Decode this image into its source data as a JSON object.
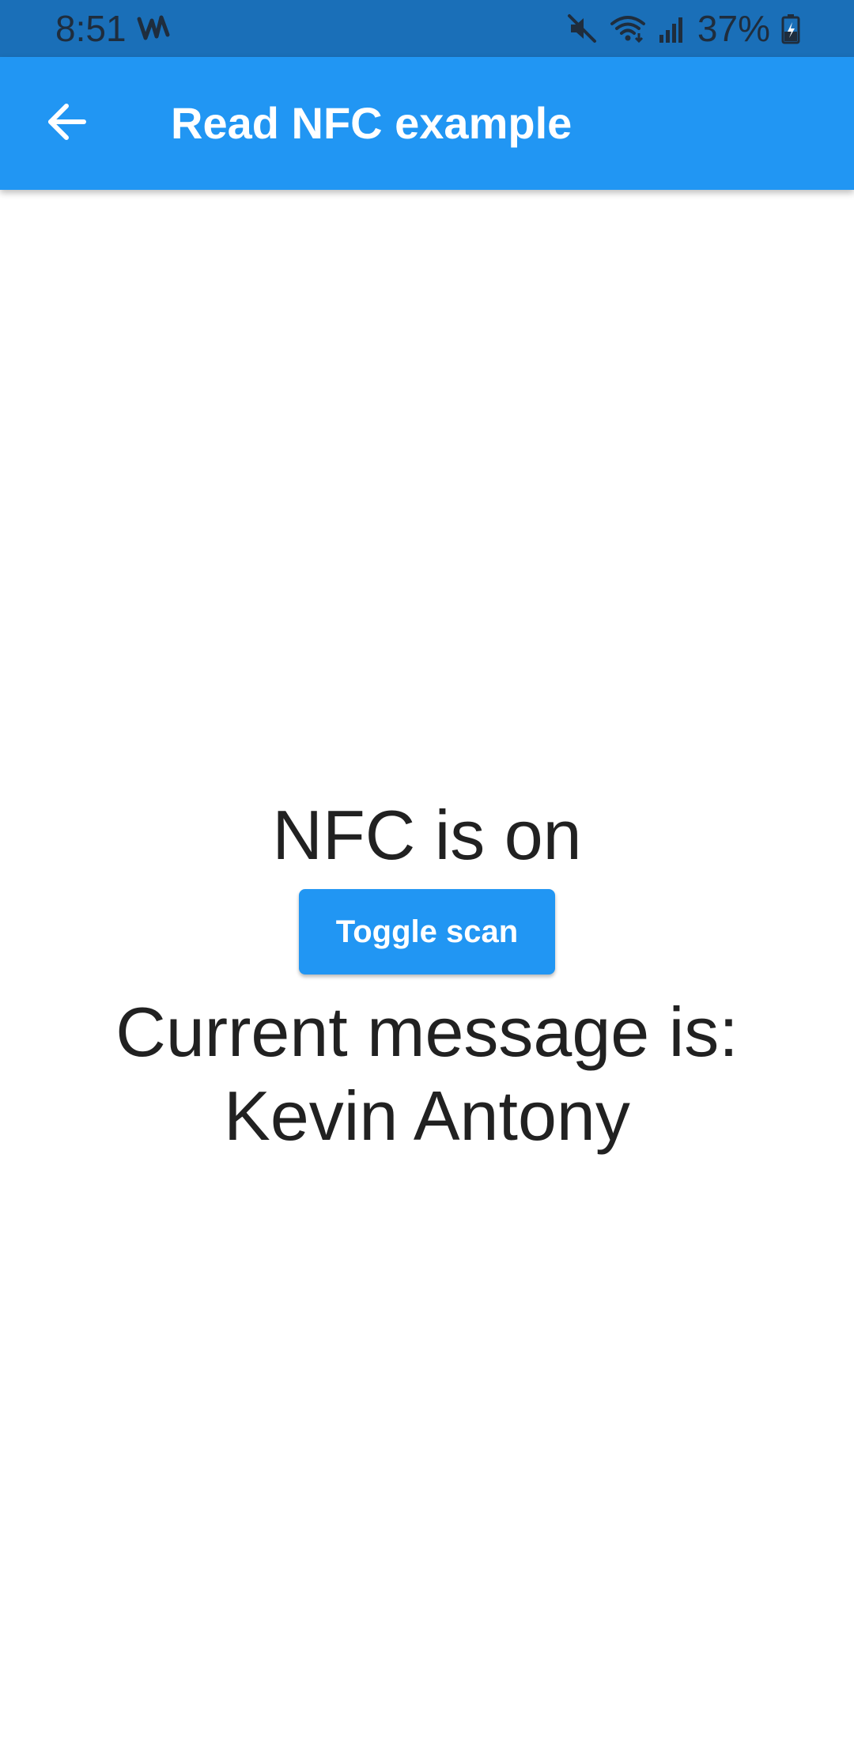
{
  "status_bar": {
    "time": "8:51",
    "battery_percent": "37%",
    "icons": [
      "pulse-app-icon",
      "mute-icon",
      "wifi-icon",
      "signal-icon",
      "battery-charging-icon"
    ],
    "background_color": "#1a6fb8"
  },
  "app_bar": {
    "title": "Read NFC example",
    "back_icon": "arrow-back-icon",
    "background_color": "#2196f3"
  },
  "main": {
    "nfc_status": "NFC is on",
    "toggle_button_label": "Toggle scan",
    "message_label": "Current message is:",
    "message_value": "Kevin Antony"
  }
}
